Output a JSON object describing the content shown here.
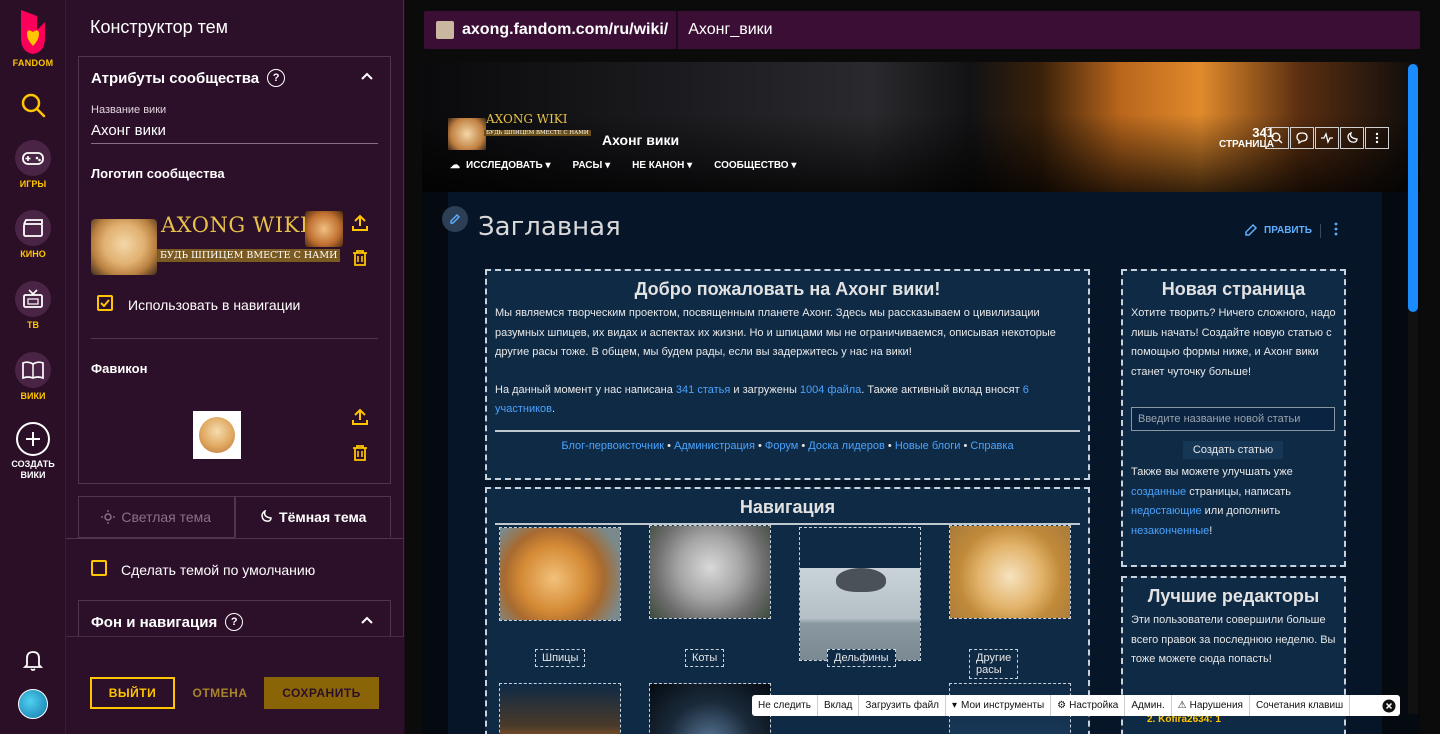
{
  "rail": {
    "logo_label": "FANDOM",
    "items": [
      {
        "label": "ИГРЫ"
      },
      {
        "label": "КИНО"
      },
      {
        "label": "ТВ"
      },
      {
        "label": "ВИКИ"
      },
      {
        "label": "СОЗДАТЬ ВИКИ"
      }
    ]
  },
  "panel": {
    "title": "Конструктор тем",
    "community": {
      "title": "Атрибуты сообщества",
      "wiki_name_label": "Название вики",
      "wiki_name_value": "Ахонг вики",
      "logo_label": "Логотип сообщества",
      "logo_text": "AXONG WIKI",
      "logo_tagline": "БУДЬ ШПИЦЕМ ВМЕСТЕ С НАМИ",
      "use_in_nav_label": "Использовать в навигации",
      "use_in_nav_checked": true,
      "favicon_label": "Фавикон"
    },
    "tabs": {
      "light": "Светлая тема",
      "dark": "Тёмная тема",
      "active": "dark"
    },
    "default_theme_label": "Сделать темой по умолчанию",
    "background_section_title": "Фон и навигация",
    "footer": {
      "exit": "ВЫЙТИ",
      "cancel": "ОТМЕНА",
      "save": "СОХРАНИТЬ"
    }
  },
  "url": {
    "domain": "axong.fandom.com/ru/wiki/",
    "page": "Ахонг_вики"
  },
  "wiki": {
    "name": "Ахонг вики",
    "nav": [
      "ИССЛЕДОВАТЬ",
      "РАСЫ",
      "НЕ КАНОН",
      "СООБЩЕСТВО"
    ],
    "page_count": "341",
    "page_count_label": "СТРАНИЦА",
    "page_title": "Заглавная",
    "edit_label": "ПРАВИТЬ",
    "welcome": {
      "title": "Добро пожаловать на Ахонг вики!",
      "p1": "Мы являемся творческим проектом, посвященным планете Ахонг. Здесь мы рассказываем о цивилизации разумных шпицев, их видах и аспектах их жизни. Но и шпицами мы не ограничиваемся, описывая некоторые другие расы тоже. В общем, мы будем рады, если вы задержитесь у нас на вики!",
      "p2_a": "На данный момент у нас написана ",
      "p2_link1": "341 статья",
      "p2_b": " и загружены ",
      "p2_link2": "1004 файла",
      "p2_c": ". Также активный вклад вносят ",
      "p2_link3": "6 участников",
      "p2_d": ".",
      "links": [
        "Блог-первоисточник",
        "Администрация",
        "Форум",
        "Доска лидеров",
        "Новые блоги",
        "Справка"
      ]
    },
    "navigation": {
      "title": "Навигация",
      "cards": [
        "Шпицы",
        "Коты",
        "Дельфины",
        "Другие расы"
      ]
    },
    "new_page": {
      "title": "Новая страница",
      "text": "Хотите творить? Ничего сложного, надо лишь начать! Создайте новую статью с помощью формы ниже, и Ахонг вики станет чуточку больше!",
      "placeholder": "Введите название новой статьи",
      "button": "Создать статью",
      "more_a": "Также вы можете улучшать уже ",
      "more_link1": "созданные",
      "more_b": " страницы, написать ",
      "more_link2": "недостающие",
      "more_c": " или дополнить ",
      "more_link3": "незаконченные",
      "more_d": "!"
    },
    "editors": {
      "title": "Лучшие редакторы",
      "text": "Эти пользователи совершили больше всего правок за последнюю неделю. Вы тоже можете сюда попасть!",
      "entry": "2. Kofira2634: 1"
    }
  },
  "toolbar": [
    "Не следить",
    "Вклад",
    "Загрузить файл",
    "Мои инструменты",
    "Настройка",
    "Админ.",
    "Нарушения",
    "Сочетания клавиш"
  ]
}
